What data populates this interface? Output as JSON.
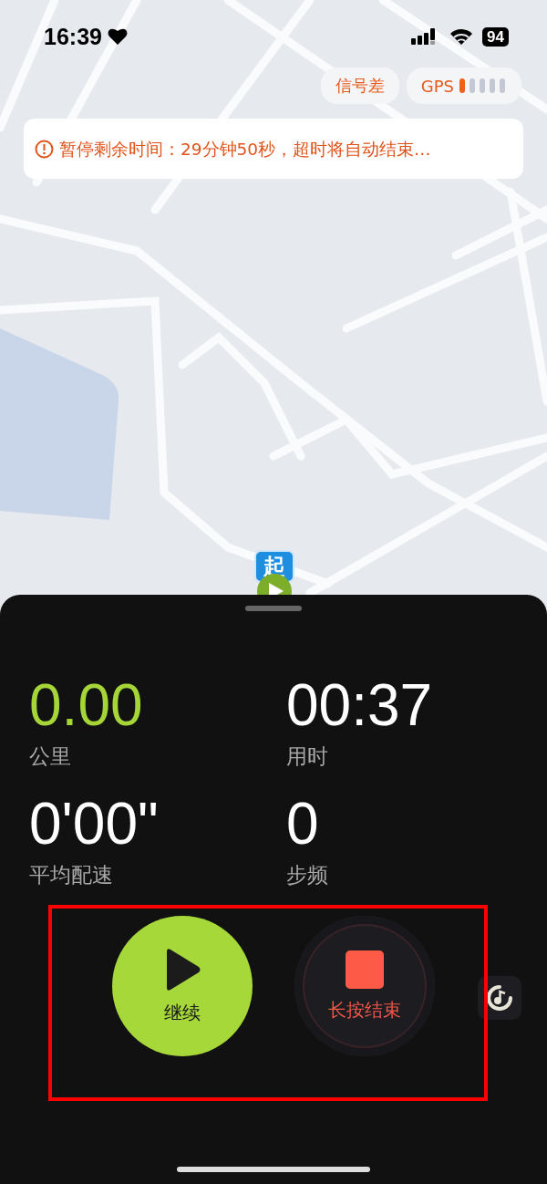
{
  "status_bar": {
    "time": "16:39",
    "battery": "94"
  },
  "signal_chip": "信号差",
  "gps_chip": {
    "label": "GPS"
  },
  "notice": "暂停剩余时间：29分钟50秒，超时将自动结束…",
  "map": {
    "kind": "picture",
    "start_marker": "起"
  },
  "stats": [
    {
      "value": "0.00",
      "label": "公里",
      "highlight": true
    },
    {
      "value": "00:37",
      "label": "用时",
      "highlight": false
    },
    {
      "value": "0'00\"",
      "label": "平均配速",
      "highlight": false
    },
    {
      "value": "0",
      "label": "步频",
      "highlight": false
    }
  ],
  "buttons": [
    {
      "kind": "resume",
      "label": "继续"
    },
    {
      "kind": "stop",
      "label": "长按结束"
    }
  ]
}
